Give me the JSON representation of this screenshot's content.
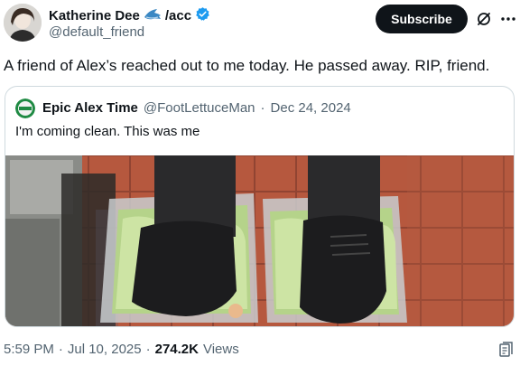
{
  "author": {
    "display_name": "Katherine Dee",
    "name_suffix": "/acc",
    "handle": "@default_friend",
    "badge_color": "#1d9bf0"
  },
  "actions": {
    "subscribe_label": "Subscribe",
    "grok_icon": "grok-icon",
    "more_icon": "more-icon"
  },
  "tweet": {
    "text": "A friend of Alex’s reached out to me today. He passed away. RIP, friend."
  },
  "quoted_tweet": {
    "display_name": "Epic Alex Time",
    "handle": "@FootLettuceMan",
    "separator": "·",
    "date": "Dec 24, 2024",
    "text": "I'm coming clean. This was me",
    "media_description_icon": "photo"
  },
  "footer": {
    "time": "5:59 PM",
    "separator": "·",
    "date": "Jul 10, 2025",
    "views_count": "274.2K",
    "views_label": "Views",
    "bookmark_icon": "bookmark-icon"
  }
}
